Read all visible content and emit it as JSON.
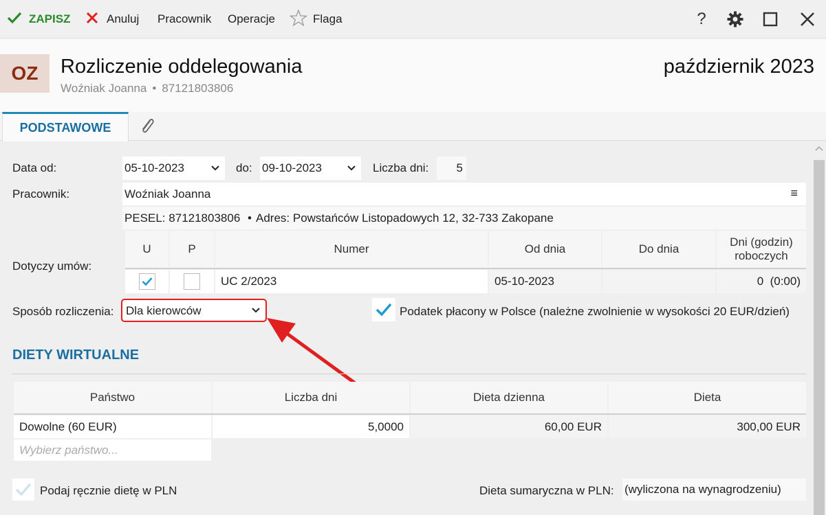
{
  "toolbar": {
    "save_label": "ZAPISZ",
    "cancel_label": "Anuluj",
    "worker_label": "Pracownik",
    "operations_label": "Operacje",
    "flag_label": "Flaga",
    "help_label": "?",
    "icons": {
      "save": "check-icon",
      "cancel": "x-icon",
      "flag": "star-icon",
      "settings": "gear-icon",
      "maximize": "square-icon",
      "close": "close-icon"
    }
  },
  "header": {
    "avatar": "OZ",
    "title": "Rozliczenie oddelegowania",
    "employee": "Woźniak Joanna",
    "pesel": "87121803806",
    "separator": "•",
    "period": "październik 2023"
  },
  "tabs": {
    "basic": "PODSTAWOWE",
    "attachments_icon": "paperclip-icon"
  },
  "form": {
    "date_from_label": "Data od:",
    "date_from": "05-10-2023",
    "date_to_label": "do:",
    "date_to": "09-10-2023",
    "days_label": "Liczba dni:",
    "days": "5",
    "worker_label": "Pracownik:",
    "worker": "Woźniak Joanna",
    "worker_menu": "≡",
    "pesel_label": "PESEL:",
    "pesel": "87121803806",
    "address_sep": "•",
    "address_label": "Adres:",
    "address": "Powstańców Listopadowych 12, 32-733 Zakopane",
    "contracts_label": "Dotyczy umów:",
    "contracts_headers": [
      "U",
      "P",
      "Numer",
      "Od dnia",
      "Do dnia",
      "Dni (godzin) roboczych"
    ],
    "contracts": [
      {
        "u": true,
        "p": false,
        "number": "UC 2/2023",
        "from": "05-10-2023",
        "to": "",
        "days": "0  (0:00)"
      }
    ],
    "settlement_label": "Sposób rozliczenia:",
    "settlement": "Dla kierowców",
    "tax_label": "Podatek płacony w Polsce (należne zwolnienie w wysokości 20 EUR/dzień)",
    "tax_checked": true
  },
  "allowances": {
    "title": "DIETY WIRTUALNE",
    "headers": [
      "Państwo",
      "Liczba dni",
      "Dieta dzienna",
      "Dieta"
    ],
    "rows": [
      {
        "country": "Dowolne (60 EUR)",
        "days": "5,0000",
        "daily": "60,00 EUR",
        "total": "300,00 EUR"
      }
    ],
    "country_placeholder": "Wybierz państwo...",
    "manual_label": "Podaj ręcznie dietę w PLN",
    "manual_checked": false,
    "sum_label": "Dieta sumaryczna w PLN:",
    "sum_value": "(wyliczona na wynagrodzeniu)"
  },
  "colors": {
    "accent": "#1a6fa0",
    "save": "#2a8a2a",
    "cancel": "#e02020",
    "highlight": "#e02020",
    "check": "#1e9bd7"
  }
}
